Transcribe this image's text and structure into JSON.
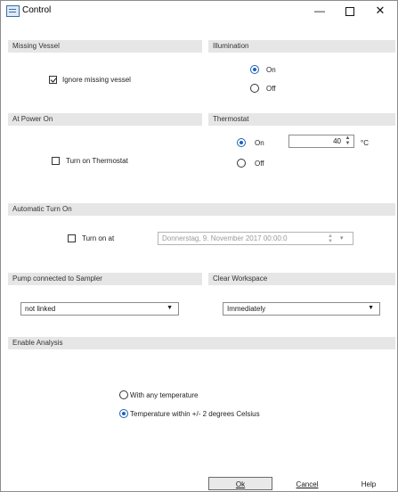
{
  "window": {
    "title": "Control",
    "minimize": "—",
    "close": "✕"
  },
  "sections": {
    "missing_vessel": "Missing Vessel",
    "illumination": "Illumination",
    "at_power_on": "At Power On",
    "thermostat": "Thermostat",
    "automatic_turn_on": "Automatic Turn On",
    "pump_connected": "Pump connected to Sampler",
    "clear_workspace": "Clear Workspace",
    "enable_analysis": "Enable Analysis"
  },
  "missing_vessel": {
    "ignore_label": "Ignore missing vessel",
    "ignore_checked": true
  },
  "illumination": {
    "on_label": "On",
    "off_label": "Off",
    "selected": "On"
  },
  "at_power_on": {
    "turn_on_thermostat_label": "Turn on Thermostat",
    "checked": false
  },
  "thermostat": {
    "on_label": "On",
    "off_label": "Off",
    "selected": "On",
    "value": "40",
    "unit": "°C"
  },
  "automatic_turn_on": {
    "turn_on_at_label": "Turn on at",
    "checked": false,
    "datetime": "Donnerstag, 9. November 2017  00:00:0"
  },
  "pump": {
    "selected": "not linked"
  },
  "clear_workspace": {
    "selected": "Immediately"
  },
  "enable_analysis": {
    "option_any": "With any temperature",
    "option_within": "Temperature within +/- 2 degrees Celsius",
    "selected": "option_within"
  },
  "buttons": {
    "ok": "Ok",
    "cancel": "Cancel",
    "help": "Help"
  },
  "icons": {
    "app": "control-panel-icon",
    "dropdown": "chevron-down-icon",
    "spinner": "up-down-arrows-icon"
  }
}
